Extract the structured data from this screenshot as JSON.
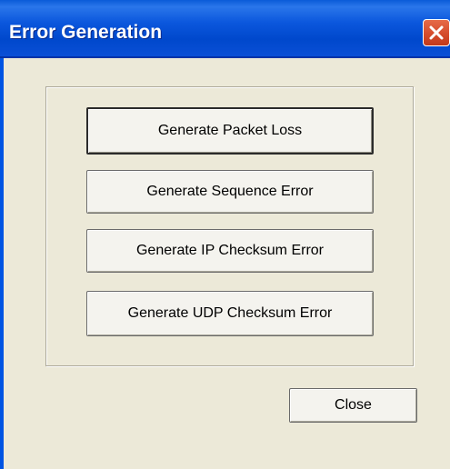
{
  "window": {
    "title": "Error Generation",
    "close_icon": "close-icon"
  },
  "buttons": {
    "packet_loss": "Generate Packet Loss",
    "sequence_error": "Generate Sequence Error",
    "ip_checksum_error": "Generate IP Checksum Error",
    "udp_checksum_error": "Generate UDP Checksum Error",
    "close": "Close"
  },
  "colors": {
    "titlebar": "#0054e3",
    "close_button": "#d34a2a",
    "dialog_face": "#ece9d8"
  }
}
